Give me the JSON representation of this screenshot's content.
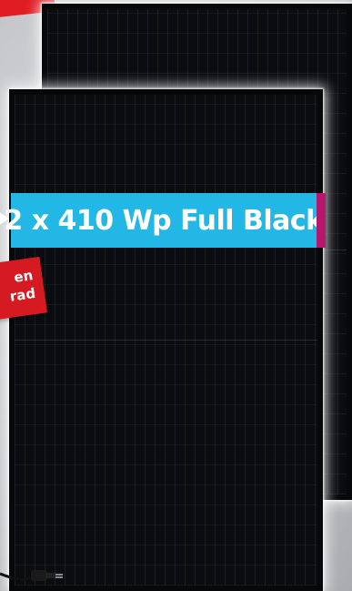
{
  "banner": {
    "text": "2 x 410 Wp Full Black"
  },
  "badge": {
    "line1": "en",
    "line2": "rad"
  },
  "colors": {
    "banner": "#23b7e5",
    "banner_accent": "#b8166c",
    "badge": "#d61a22",
    "panel": "#07080a",
    "background": "#c4c6c9"
  }
}
